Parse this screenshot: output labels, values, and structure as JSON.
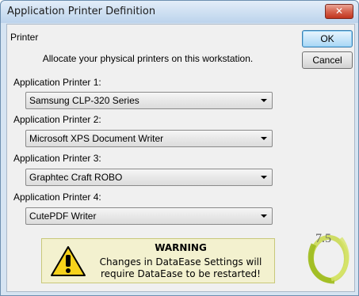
{
  "window": {
    "title": "Application Printer Definition",
    "close_glyph": "✕"
  },
  "section_label": "Printer",
  "info_text": "Allocate your physical printers on this workstation.",
  "printers": [
    {
      "label": "Application Printer 1:",
      "value": "Samsung CLP-320 Series"
    },
    {
      "label": "Application Printer 2:",
      "value": "Microsoft XPS Document Writer"
    },
    {
      "label": "Application Printer 3:",
      "value": "Graphtec Craft ROBO"
    },
    {
      "label": "Application Printer 4:",
      "value": "CutePDF Writer"
    }
  ],
  "buttons": {
    "ok": "OK",
    "cancel": "Cancel"
  },
  "warning": {
    "title": "WARNING",
    "line1": "Changes in DataEase Settings will",
    "line2": "require DataEase to be restarted!",
    "icon": "warning-icon"
  },
  "logo": {
    "text": "7.5"
  },
  "colors": {
    "warning_bg": "#f3f1cf",
    "warning_icon": "#f6d21a",
    "logo_green": "#b5cc2e"
  }
}
